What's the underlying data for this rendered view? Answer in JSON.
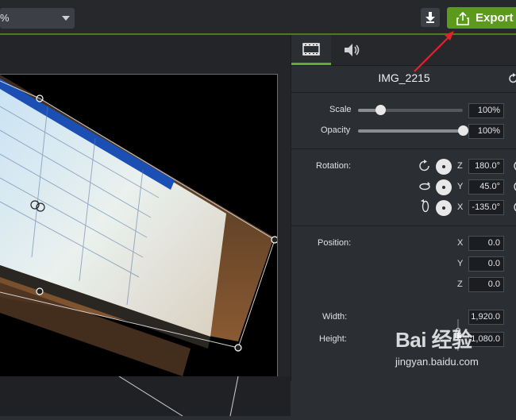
{
  "toolbar": {
    "zoom_value": "%",
    "export_label": "Export",
    "download_icon": "download-icon",
    "export_icon": "share-export-icon"
  },
  "canvas": {
    "media_name": "IMG_2215",
    "description_icon": "photo-of-monitor"
  },
  "tabs": [
    {
      "name": "visual-properties",
      "icon": "film-icon",
      "active": true
    },
    {
      "name": "audio-properties",
      "icon": "speaker-icon",
      "active": false
    }
  ],
  "properties": {
    "title": "IMG_2215",
    "scale": {
      "label": "Scale",
      "value": "100%",
      "level": 0.21
    },
    "opacity": {
      "label": "Opacity",
      "value": "100%",
      "level": 1.0
    },
    "rotation": {
      "label": "Rotation:",
      "z": {
        "axis": "Z",
        "value": "180.0°"
      },
      "y": {
        "axis": "Y",
        "value": "45.0°"
      },
      "x": {
        "axis": "X",
        "value": "-135.0°"
      }
    },
    "position": {
      "label": "Position:",
      "x": {
        "axis": "X",
        "value": "0.0"
      },
      "y": {
        "axis": "Y",
        "value": "0.0"
      },
      "z": {
        "axis": "Z",
        "value": "0.0"
      }
    },
    "width": {
      "label": "Width:",
      "value": "1,920.0"
    },
    "height": {
      "label": "Height:",
      "value": "1,080.0"
    }
  },
  "watermark": {
    "brand": "Bai 经验",
    "url": "jingyan.baidu.com"
  },
  "colors": {
    "accent_green": "#5c9a1d",
    "annotation_red": "#e0242b"
  }
}
